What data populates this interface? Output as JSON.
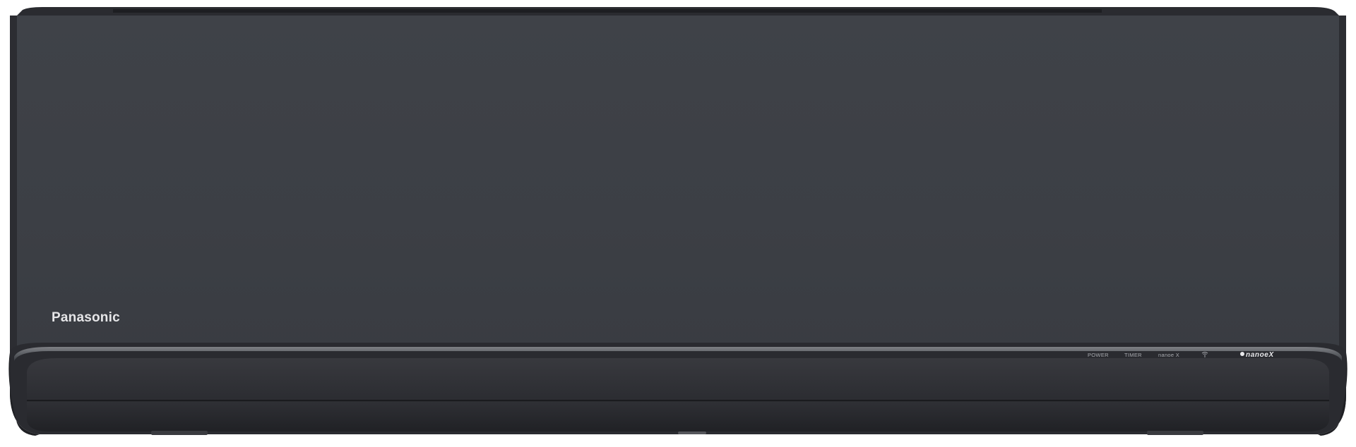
{
  "device": {
    "brand": "Panasonic",
    "kind": "wall-mounted air conditioner indoor unit",
    "finish_color": "#3c3f45"
  },
  "indicators": {
    "power": "POWER",
    "timer": "TIMER",
    "nanoe": "nanoe X",
    "wifi_icon": "wifi-icon",
    "logo": "nanoeX"
  }
}
